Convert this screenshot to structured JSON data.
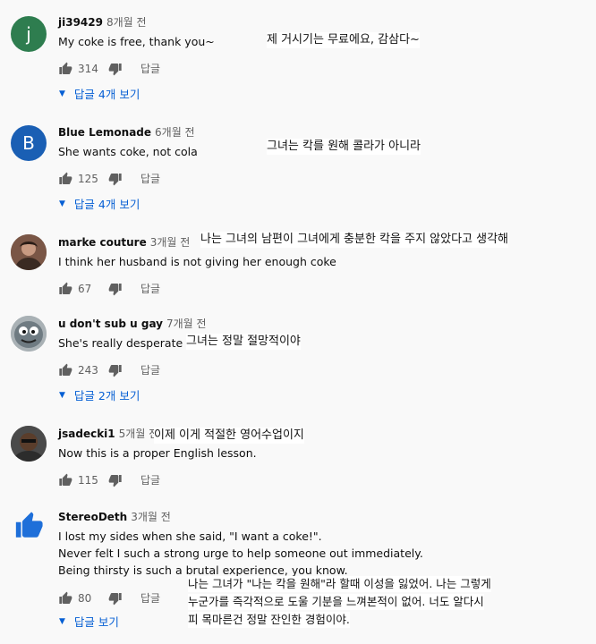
{
  "ui": {
    "reply_label": "답글"
  },
  "comments": [
    {
      "author": "ji39429",
      "time": "8개월 전",
      "text": "My coke is free, thank you~",
      "likes": "314",
      "replies": "답글 4개 보기",
      "avatar_letter": "j",
      "avatar_color": "#2e7d4f",
      "translation": "제 거시기는 무료에요, 감삼다~"
    },
    {
      "author": "Blue Lemonade",
      "time": "6개월 전",
      "text": "She wants coke, not cola",
      "likes": "125",
      "replies": "답글 4개 보기",
      "avatar_letter": "B",
      "avatar_color": "#1a5fb4",
      "translation": "그녀는 칵를 원해 콜라가 아니라"
    },
    {
      "author": "marke couture",
      "time": "3개월 전",
      "text": "I think her husband is not giving her enough coke",
      "likes": "67",
      "translation": "나는 그녀의 남편이 그녀에게 충분한 칵을 주지 않았다고 생각해"
    },
    {
      "author": "u don't sub u gay",
      "time": "7개월 전",
      "text": "She's really desperate",
      "likes": "243",
      "replies": "답글 2개 보기",
      "translation": "그녀는 정말 절망적이야"
    },
    {
      "author": "jsadecki1",
      "time": "5개월 전",
      "text": "Now this is a proper English lesson.",
      "likes": "115",
      "translation": "이제 이게 적절한 영어수업이지"
    },
    {
      "author": "StereoDeth",
      "time": "3개월 전",
      "text_lines": [
        "I lost my sides when she said, \"I want a coke!\".",
        "Never felt I such a strong urge to help someone out immediately.",
        "Being thirsty is such a brutal experience, you know."
      ],
      "likes": "80",
      "replies": "답글 보기",
      "translation_lines": [
        "나는 그녀가 \"나는 칵을 원해\"라 할때 이성을 잃었어. 나는 그렇게",
        "누군가를 즉각적으로 도울  기분을 느껴본적이 없어. 너도 알다시",
        "피 목마른건 정말 잔인한 경험이야."
      ]
    }
  ]
}
